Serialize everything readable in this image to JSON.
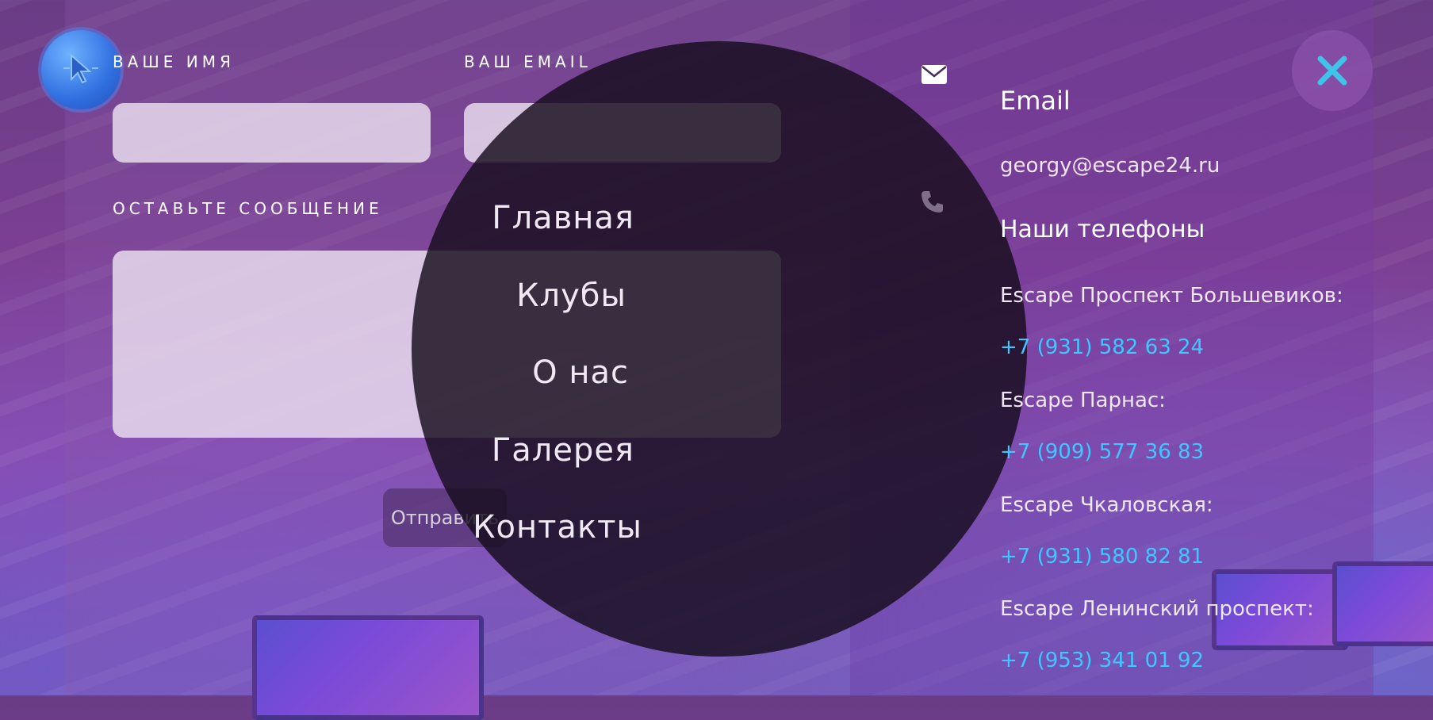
{
  "form": {
    "name_label": "ВАШЕ ИМЯ",
    "email_label": "ВАШ EMAIL",
    "message_label": "ОСТАВЬТЕ СООБЩЕНИЕ",
    "submit_label": "Отправить"
  },
  "nav": {
    "items": [
      "Главная",
      "Клубы",
      "О нас",
      "Галерея",
      "Контакты"
    ]
  },
  "contacts": {
    "email_heading": "Email",
    "email_value": "georgy@escape24.ru",
    "phones_heading": "Наши телефоны",
    "clubs": [
      {
        "name": "Escape Проспект Большевиков:",
        "phone": "+7 (931) 582 63 24"
      },
      {
        "name": "Escape Парнас:",
        "phone": "+7 (909) 577 36 83"
      },
      {
        "name": "Escape Чкаловская:",
        "phone": "+7 (931) 580 82 81"
      },
      {
        "name": "Escape Ленинский проспект:",
        "phone": "+7 (953) 341 01 92"
      }
    ]
  },
  "icons": {
    "cursor": "cursor-icon",
    "close": "close-icon",
    "email": "envelope-icon",
    "phone": "phone-icon"
  },
  "colors": {
    "accent": "#3fc8ff",
    "close": "#3fc3e8"
  }
}
